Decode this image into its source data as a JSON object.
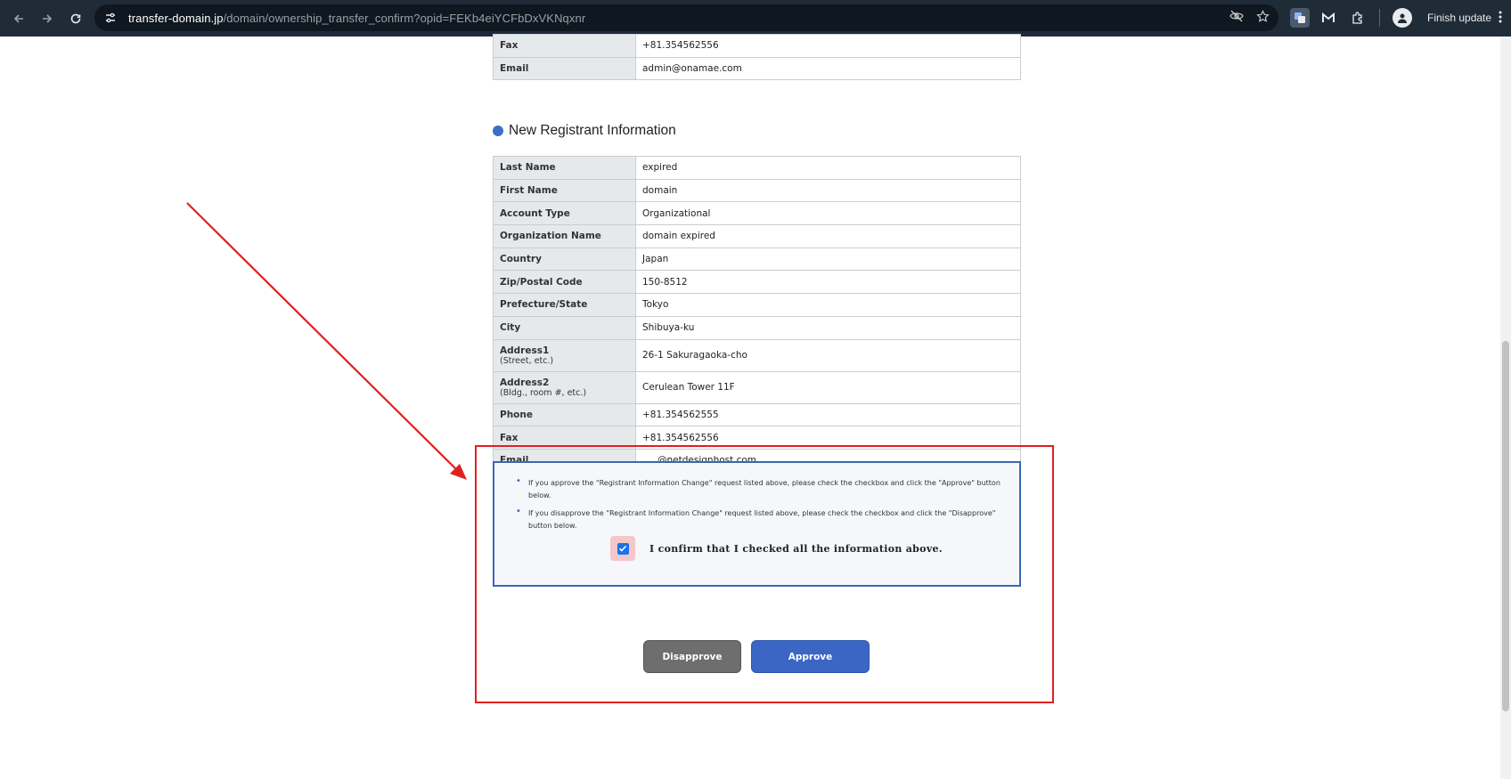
{
  "browser": {
    "url_host": "transfer-domain.jp",
    "url_path": "/domain/ownership_transfer_confirm?opid=FEKb4eiYCFbDxVKNqxnr",
    "finish_update_label": "Finish update"
  },
  "previous_table": {
    "rows": [
      {
        "label": "Fax",
        "value": "+81.354562556"
      },
      {
        "label": "Email",
        "value": "admin@onamae.com"
      }
    ]
  },
  "new_registrant": {
    "title": "New Registrant Information",
    "rows": [
      {
        "label": "Last Name",
        "value": "expired"
      },
      {
        "label": "First Name",
        "value": "domain"
      },
      {
        "label": "Account Type",
        "value": "Organizational"
      },
      {
        "label": "Organization Name",
        "value": "domain expired"
      },
      {
        "label": "Country",
        "value": "Japan"
      },
      {
        "label": "Zip/Postal Code",
        "value": "150-8512"
      },
      {
        "label": "Prefecture/State",
        "value": "Tokyo"
      },
      {
        "label": "City",
        "value": "Shibuya-ku"
      },
      {
        "label": "Address1",
        "sub": "(Street, etc.)",
        "value": "26-1 Sakuragaoka-cho"
      },
      {
        "label": "Address2",
        "sub": "(Bldg., room #, etc.)",
        "value": "Cerulean Tower 11F"
      },
      {
        "label": "Phone",
        "value": "+81.354562555"
      },
      {
        "label": "Fax",
        "value": "+81.354562556"
      },
      {
        "label": "Email",
        "value": "@netdesignhost.com"
      }
    ]
  },
  "confirm": {
    "notes": [
      "If you approve the \"Registrant Information Change\" request listed above, please check the checkbox and click the \"Approve\" button below.",
      "If you disapprove the \"Registrant Information Change\" request listed above, please check the checkbox and click the \"Disapprove\" button below."
    ],
    "checkbox_label": "I confirm that I checked all the information above.",
    "checked": true
  },
  "buttons": {
    "disapprove": "Disapprove",
    "approve": "Approve"
  },
  "colors": {
    "annotation_red": "#e02020",
    "panel_border": "#3b66b3",
    "approve_blue": "#3b66c4",
    "disapprove_gray": "#6e6e6e"
  }
}
